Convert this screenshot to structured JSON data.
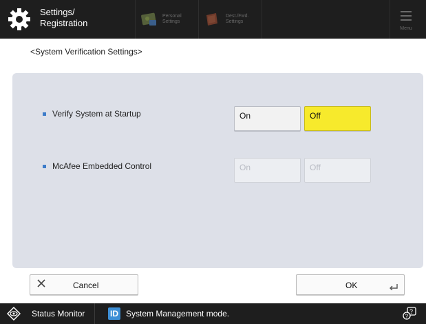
{
  "header": {
    "title_line1": "Settings/",
    "title_line2": "Registration",
    "personal_settings": {
      "line1": "Personal",
      "line2": "Settings"
    },
    "dest_fwd_settings": {
      "line1": "Dest./Fwd.",
      "line2": "Settings"
    },
    "menu_label": "Menu"
  },
  "page": {
    "heading": "<System Verification Settings>"
  },
  "settings": [
    {
      "label": "Verify System at Startup",
      "on_label": "On",
      "off_label": "Off",
      "selected": "Off",
      "enabled": true
    },
    {
      "label": "McAfee Embedded Control",
      "on_label": "On",
      "off_label": "Off",
      "selected": null,
      "enabled": false
    }
  ],
  "footer_buttons": {
    "cancel_label": "Cancel",
    "ok_label": "OK"
  },
  "statusbar": {
    "status_monitor_label": "Status Monitor",
    "id_badge": "ID",
    "mode_text": "System Management mode."
  },
  "colors": {
    "topbar_bg": "#1e1e1e",
    "panel_bg": "#dde0e8",
    "selected_bg": "#f7ea2c",
    "accent_blue": "#3d8fd6"
  },
  "icons": {
    "settings": "gear-icon",
    "personal": "personal-settings-icon",
    "dest": "dest-fwd-settings-icon",
    "menu": "hamburger-menu-icon",
    "cancel": "close-x-icon",
    "ok": "return-arrow-icon",
    "status": "status-monitor-icon",
    "help": "help-icon"
  }
}
